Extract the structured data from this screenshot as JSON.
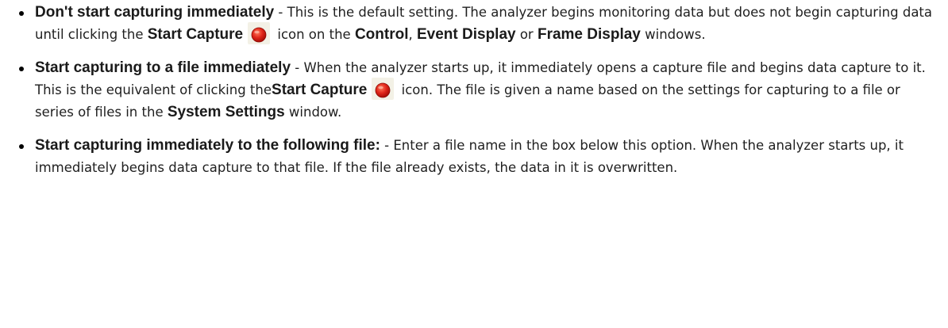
{
  "items": [
    {
      "term": "Don't start capturing immediately",
      "sep": " - ",
      "text1": "This is the default setting. The analyzer begins monitoring data but does not begin capturing data until clicking the ",
      "ui1": "Start Capture",
      "text2": " icon on the ",
      "ui2": "Control",
      "text3": ", ",
      "ui3": "Event Display",
      "text4": " or ",
      "ui4": "Frame Display",
      "text5": " windows."
    },
    {
      "term": "Start capturing to a file immediately",
      "sep": " - ",
      "text1": "When the analyzer starts up, it immediately opens a capture file and begins data capture to it. This is the equivalent of clicking the",
      "ui1": "Start Capture",
      "text2": " icon. The file is given a name based on the settings for capturing to a file or series of files in the ",
      "ui2": "System Settings",
      "text3": " window."
    },
    {
      "term": "Start capturing immediately to the following file:",
      "sep": " - ",
      "text1": "Enter a file name in the box below this option. When the analyzer starts up, it immediately begins data capture to that file. If the file already exists, the data in it is overwritten."
    }
  ],
  "icons": {
    "start_capture": "record-red-circle-icon",
    "icon_color": "#e0261a"
  }
}
